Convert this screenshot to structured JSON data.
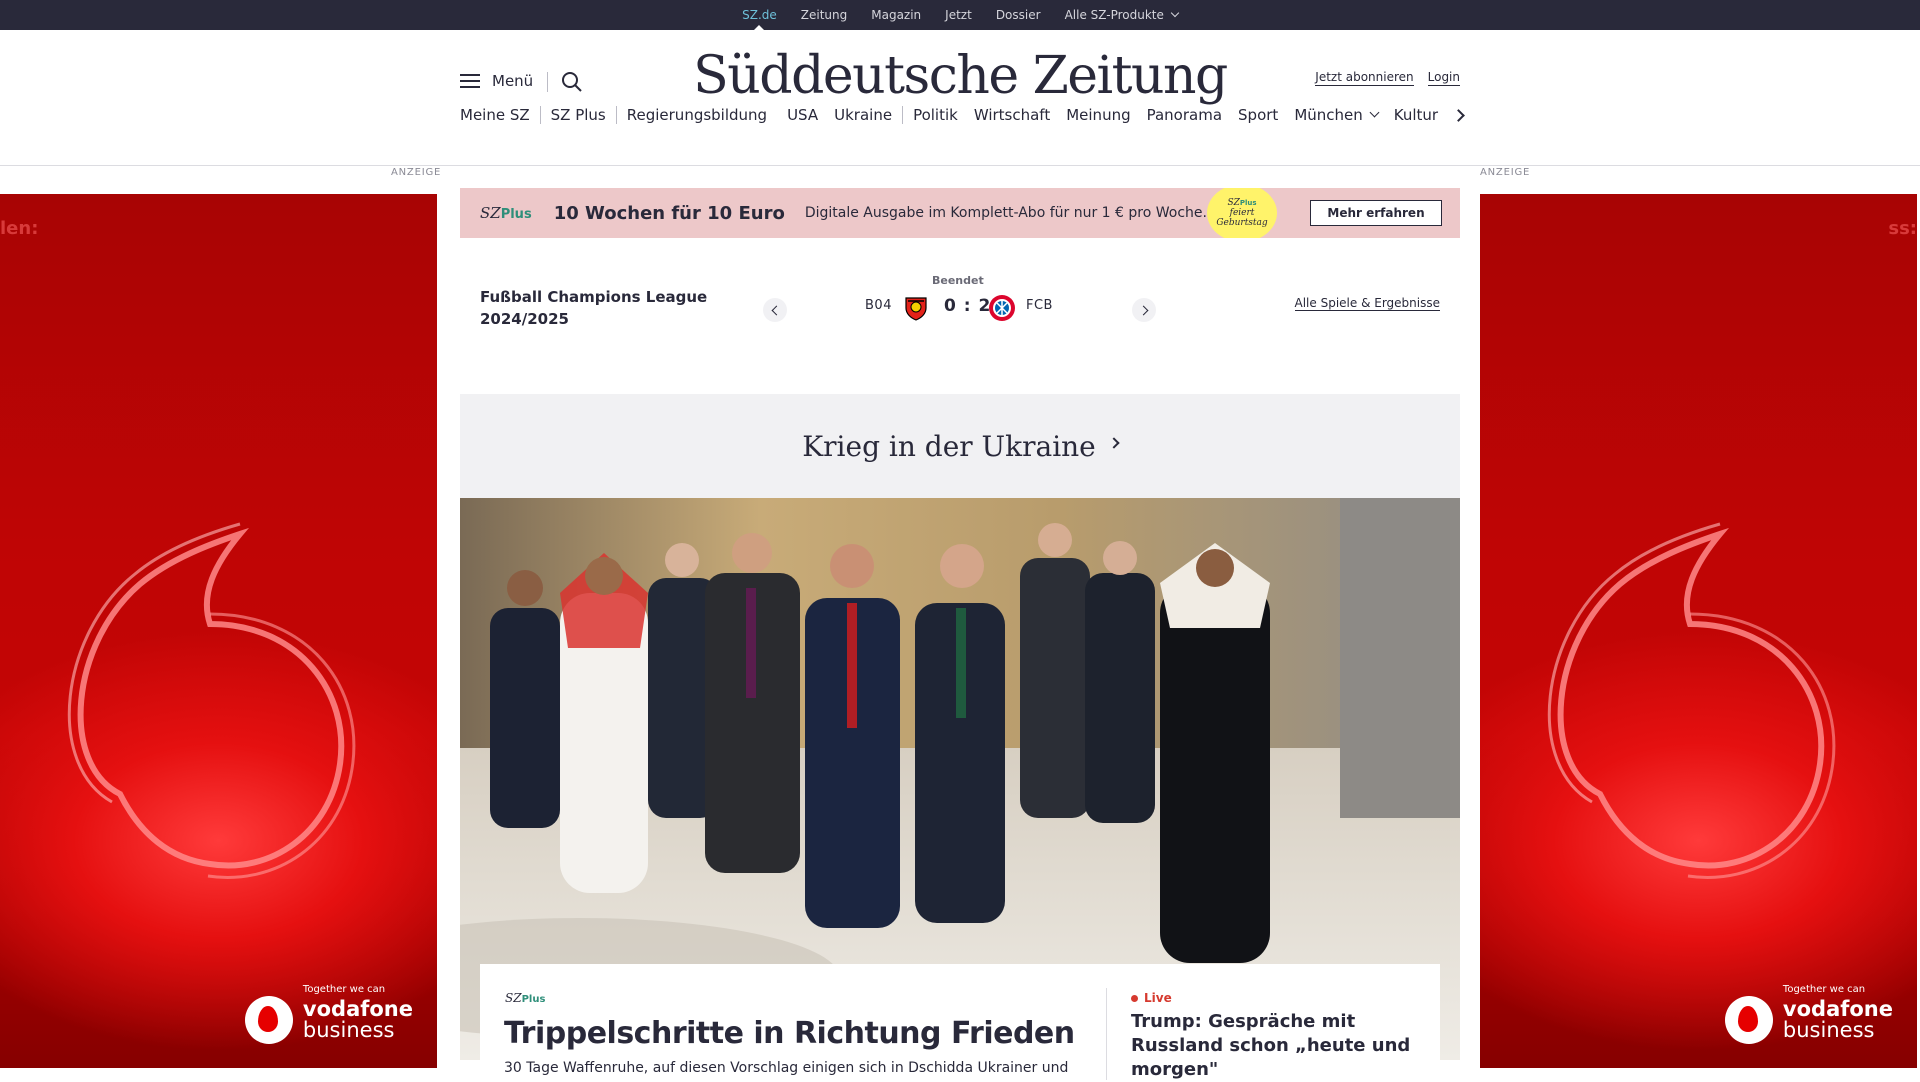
{
  "topbar": {
    "items": [
      "SZ.de",
      "Zeitung",
      "Magazin",
      "Jetzt",
      "Dossier",
      "Alle SZ-Produkte"
    ]
  },
  "header": {
    "menu_label": "Menü",
    "logo": "Süddeutsche Zeitung",
    "subscribe": "Jetzt abonnieren",
    "login": "Login"
  },
  "nav": {
    "items": [
      "Meine SZ",
      "SZ Plus",
      "Regierungsbildung",
      "USA",
      "Ukraine",
      "Politik",
      "Wirtschaft",
      "Meinung",
      "Panorama",
      "Sport",
      "München",
      "Kultur"
    ]
  },
  "ads": {
    "label": "ANZEIGE",
    "left_text": "len:",
    "right_text": "ss:",
    "slogan": "Together we can",
    "brand_line1": "vodafone",
    "brand_line2": "business",
    "colors": {
      "ad_red": "#c40505"
    }
  },
  "promo": {
    "brand": "SZ",
    "brand_plus": "Plus",
    "headline": "10 Wochen für 10 Euro",
    "sub": "Digitale Ausgabe im Komplett-Abo für nur 1 € pro Woche.",
    "badge_brand": "SZ",
    "badge_plus": "Plus",
    "badge_line1": "feiert",
    "badge_line2": "Geburtstag",
    "cta": "Mehr erfahren",
    "colors": {
      "bg": "#edc8c9",
      "badge": "#fff36a"
    }
  },
  "score": {
    "league_line1": "Fußball Champions League",
    "league_line2": "2024/2025",
    "status": "Beendet",
    "home": "B04",
    "result": "0 : 2",
    "away": "FCB",
    "all_link": "Alle Spiele & Ergebnisse"
  },
  "section": {
    "title": "Krieg in der Ukraine"
  },
  "lead": {
    "brand": "SZ",
    "brand_plus": "Plus",
    "headline": "Trippelschritte in Richtung Frieden",
    "teaser": "30 Tage Waffenruhe, auf diesen Vorschlag einigen sich in Dschidda Ukrainer und",
    "live_label": "Live",
    "side_headline": "Trump: Gespräche mit Russland schon „heute und morgen\""
  },
  "colors": {
    "dark": "#29293a",
    "accent_teal": "#2f8f7a",
    "live_red": "#d63a2f"
  }
}
